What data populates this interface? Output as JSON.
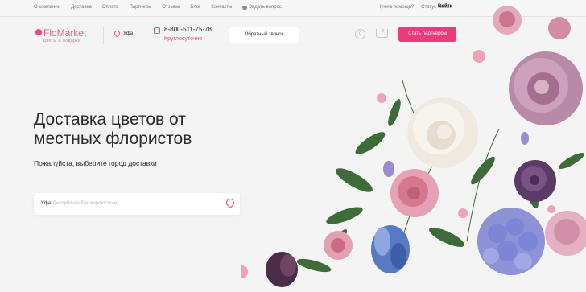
{
  "topnav": {
    "items": [
      "О компании",
      "Доставка",
      "Оплата",
      "Партнеры",
      "Отзывы",
      "Блог",
      "Контакты"
    ],
    "ask_label": "Задать вопрос",
    "help_label": "Нужна помощь?",
    "order_status_label": "Статус заказа",
    "login_label": "Войти"
  },
  "header": {
    "logo_name": "FloMarket",
    "logo_tagline": "цветы & подарки",
    "city": "Уфа",
    "phone": "8-800-511-75-78",
    "phone_note": "Круглосуточно",
    "callback_label": "Обратный звонок",
    "favorites_count": "0",
    "cart_count": "0",
    "partner_label": "Стать партнером"
  },
  "hero": {
    "title": "Доставка цветов от местных флористов",
    "subtitle": "Пожалуйста, выберите город доставки",
    "city_value": "Уфа",
    "region_placeholder": "Республика Башкортостан"
  },
  "colors": {
    "accent": "#ee3a7c",
    "background": "#f4f4f4"
  }
}
